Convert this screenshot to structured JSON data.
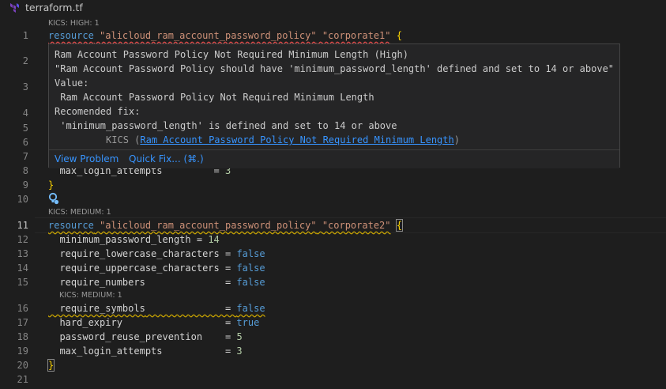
{
  "tab": {
    "title": "terraform.tf",
    "icon": "terraform-icon"
  },
  "codelens": {
    "l1": "KICS: HIGH: 1",
    "l11": "KICS: MEDIUM: 1",
    "l16": "KICS: MEDIUM: 1"
  },
  "line_numbers": [
    "1",
    "2",
    "3",
    "4",
    "5",
    "6",
    "7",
    "8",
    "9",
    "10",
    "11",
    "12",
    "13",
    "14",
    "15",
    "16",
    "17",
    "18",
    "19",
    "20",
    "21"
  ],
  "code": {
    "l1": {
      "kw": "resource",
      "s1": "\"alicloud_ram_account_password_policy\"",
      "s2": "\"corporate1\"",
      "br": "{"
    },
    "l8": {
      "attr": "  max_login_attempts",
      "eq": "         = ",
      "val": "3"
    },
    "l9": {
      "br": "}"
    },
    "l11": {
      "kw": "resource",
      "s1": "\"alicloud_ram_account_password_policy\"",
      "s2": "\"corporate2\"",
      "br": "{"
    },
    "l12": {
      "attr": "  minimum_password_length",
      "eq": " = ",
      "val": "14"
    },
    "l13": {
      "attr": "  require_lowercase_characters",
      "eq": " = ",
      "val": "false"
    },
    "l14": {
      "attr": "  require_uppercase_characters",
      "eq": " = ",
      "val": "false"
    },
    "l15": {
      "attr": "  require_numbers",
      "eq": "              = ",
      "val": "false"
    },
    "l16": {
      "attr": "  require_symbols",
      "eq": "              = ",
      "val": "false"
    },
    "l17": {
      "attr": "  hard_expiry",
      "eq": "                  = ",
      "val": "true"
    },
    "l18": {
      "attr": "  password_reuse_prevention",
      "eq": "    = ",
      "val": "5"
    },
    "l19": {
      "attr": "  max_login_attempts",
      "eq": "           = ",
      "val": "3"
    },
    "l20": {
      "br": "}"
    }
  },
  "hover": {
    "line1": "Ram Account Password Policy Not Required Minimum Length (High)",
    "line2": "\"Ram Account Password Policy should have 'minimum_password_length' defined and set to 14 or above\"",
    "line3": "Value:",
    "line4": " Ram Account Password Policy Not Required Minimum Length",
    "line5": "Recomended fix:",
    "line6": " 'minimum_password_length' is defined and set to 14 or above",
    "kics_prefix": "         KICS (",
    "kics_link": "Ram Account Password Policy Not Required Minimum Length",
    "kics_suffix": ")",
    "view_problem": "View Problem",
    "quick_fix": "Quick Fix... (⌘.)"
  },
  "colors": {
    "keyword": "#569cd6",
    "string": "#ce9178",
    "bracket": "#ffd700",
    "number": "#b5cea8",
    "link": "#3794ff",
    "error_squiggle": "#f14c4c",
    "warning_squiggle": "#cca700"
  }
}
